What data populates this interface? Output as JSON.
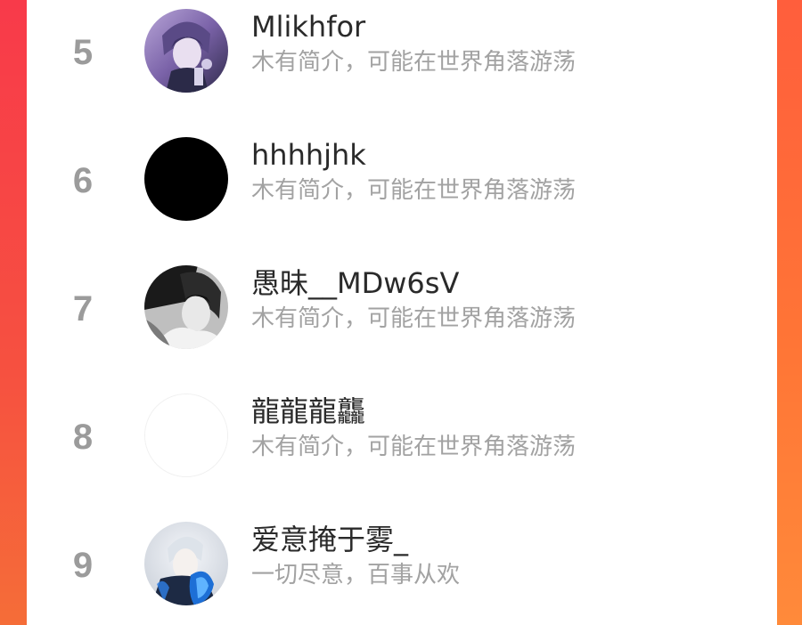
{
  "rank_list": {
    "items": [
      {
        "rank": "5",
        "name": "Mlikhfor",
        "bio": "木有简介，可能在世界角落游荡",
        "avatar": "anime-purple-avatar"
      },
      {
        "rank": "6",
        "name": "hhhhjhk",
        "bio": "木有简介，可能在世界角落游荡",
        "avatar": "black-avatar"
      },
      {
        "rank": "7",
        "name": "愚昧__MDw6sV",
        "bio": "木有简介，可能在世界角落游荡",
        "avatar": "monochrome-sketch-avatar"
      },
      {
        "rank": "8",
        "name": "龍龍龍龘",
        "bio": "木有简介，可能在世界角落游荡",
        "avatar": "blank-white-avatar"
      },
      {
        "rank": "9",
        "name": "爱意掩于雾_",
        "bio": "一切尽意，百事从欢",
        "avatar": "blue-flame-avatar"
      }
    ]
  },
  "colors": {
    "rank_gray": "#9b9b9b",
    "name_text": "#2a2a2a",
    "bio_text": "#a2a2a2",
    "side_red": "#f83a4a",
    "side_orange": "#ff7536"
  }
}
